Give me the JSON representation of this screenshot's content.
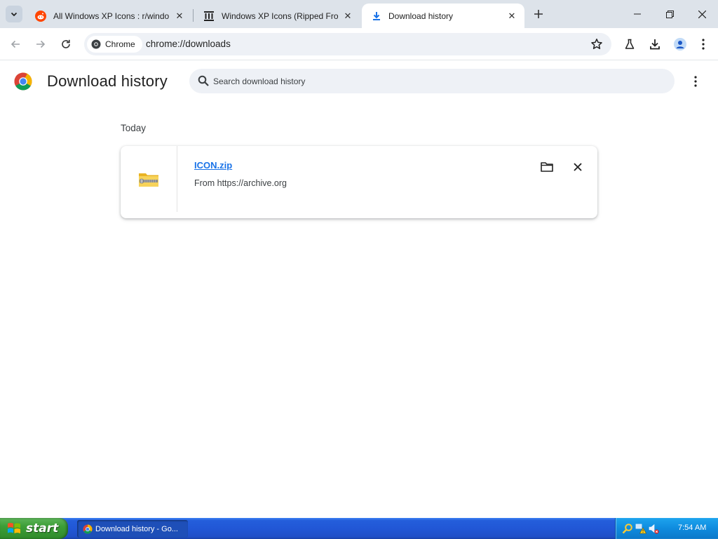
{
  "browser": {
    "tabs": [
      {
        "title": "All Windows XP Icons : r/windo",
        "icon": "reddit-icon",
        "active": false
      },
      {
        "title": "Windows XP Icons (Ripped Fro",
        "icon": "internet-archive-icon",
        "active": false
      },
      {
        "title": "Download history",
        "icon": "download-icon",
        "active": true
      }
    ],
    "omnibox": {
      "chip_label": "Chrome",
      "url": "chrome://downloads"
    },
    "colors": {
      "tabstrip": "#dde3ea",
      "omnibox": "#eef1f6",
      "link": "#1a73e8"
    }
  },
  "page": {
    "title": "Download history",
    "search_placeholder": "Search download history",
    "section_label": "Today",
    "downloads": [
      {
        "file_name": "ICON.zip",
        "source": "From https://archive.org",
        "icon": "zip-folder-icon"
      }
    ]
  },
  "taskbar": {
    "start_label": "start",
    "tasks": [
      {
        "label": "Download history - Go...",
        "icon": "chrome-icon"
      }
    ],
    "clock": "7:54 AM",
    "tray_icons": [
      "search-icon",
      "network-warning-icon",
      "volume-muted-icon"
    ]
  }
}
